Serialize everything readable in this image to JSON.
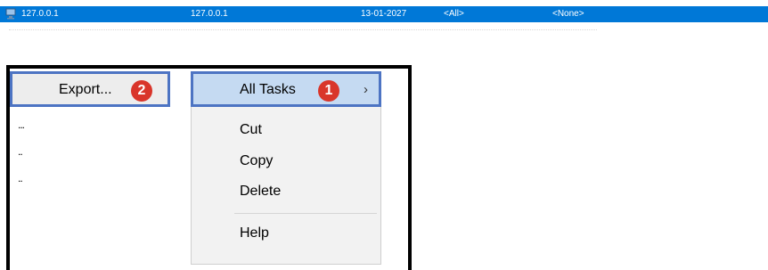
{
  "row": {
    "name": "127.0.0.1",
    "address": "127.0.0.1",
    "date": "13-01-2027",
    "scope": "<All>",
    "extra": "<None>"
  },
  "context_menu": {
    "all_tasks": "All Tasks",
    "items": [
      "Cut",
      "Copy",
      "Delete",
      "Help"
    ]
  },
  "submenu": {
    "export": "Export..."
  },
  "badges": {
    "step1": "1",
    "step2": "2"
  },
  "colors": {
    "selection": "#0078d7",
    "highlight_border": "#4d74c3",
    "badge": "#d9352a"
  }
}
